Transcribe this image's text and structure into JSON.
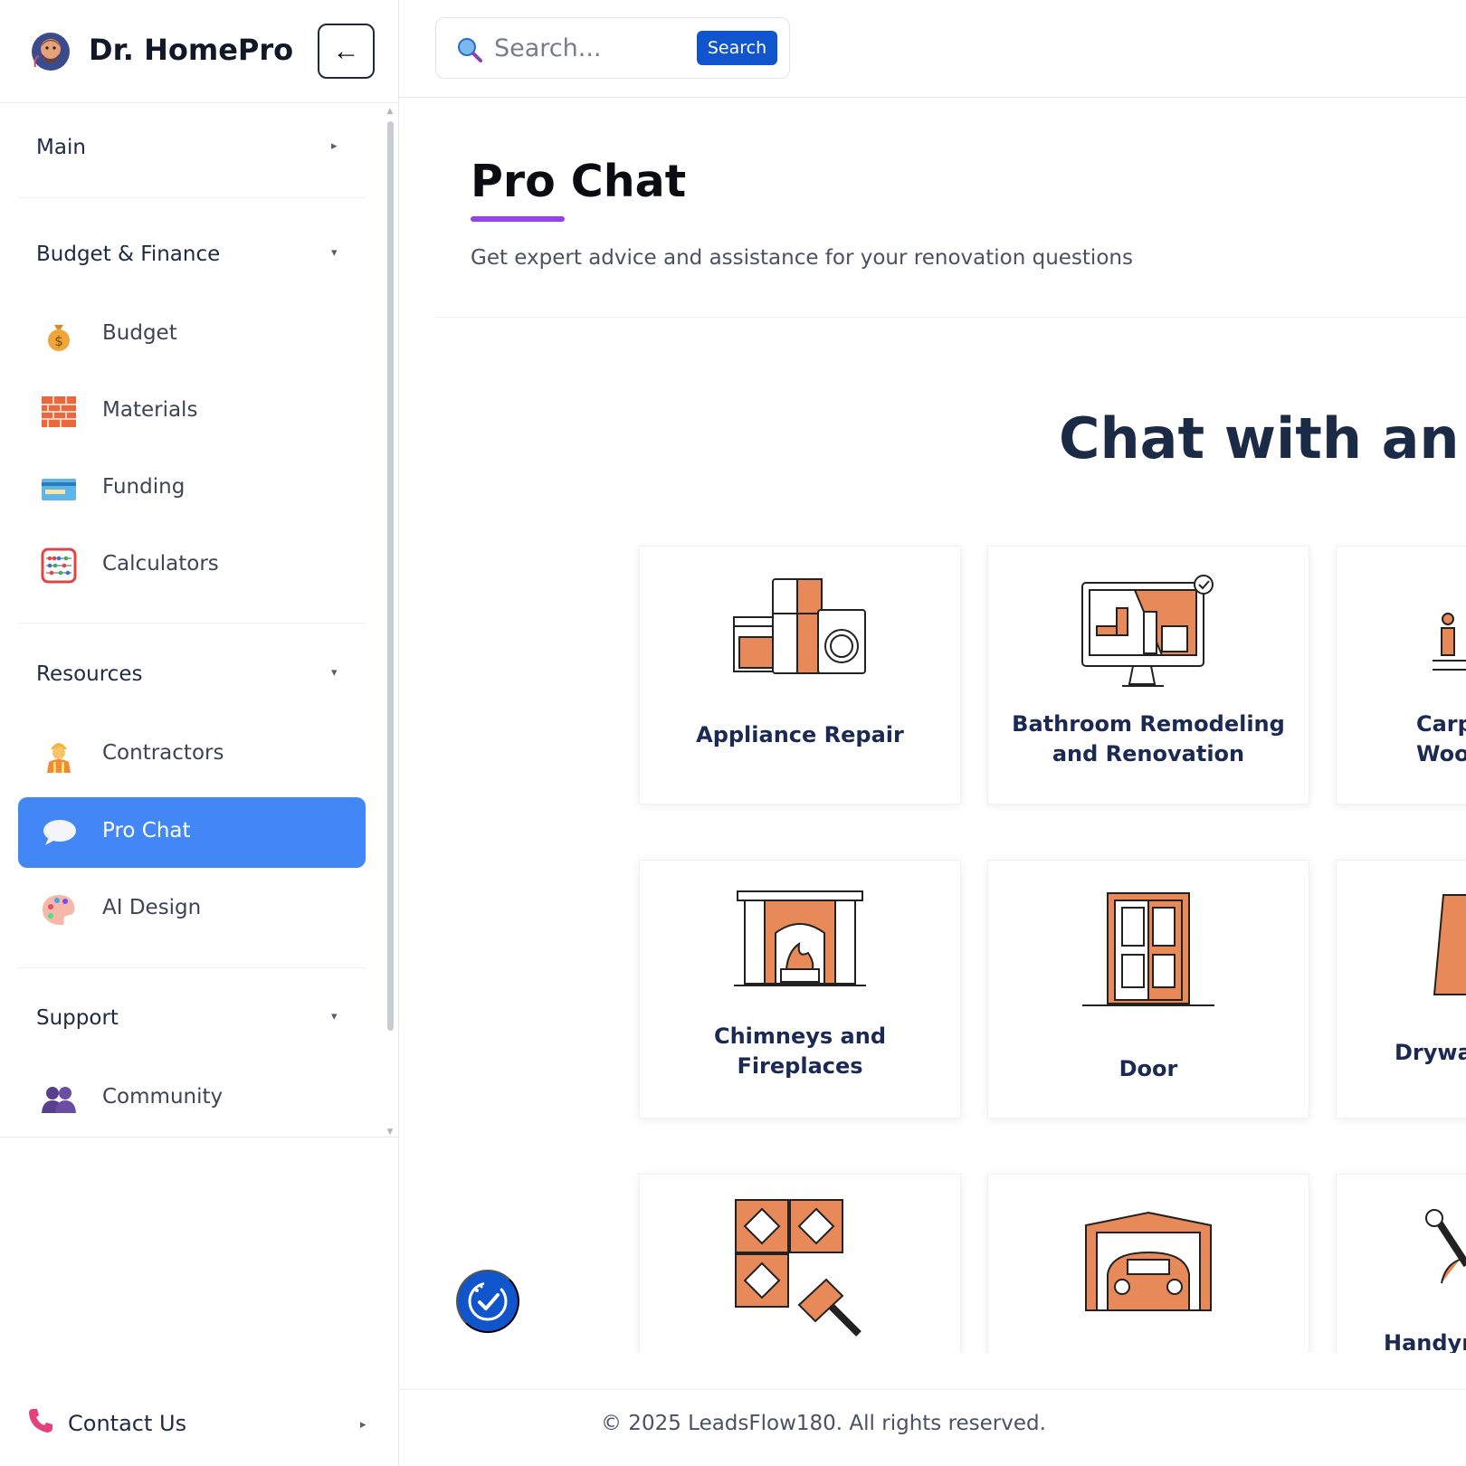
{
  "brand": {
    "name": "Dr. HomePro",
    "collapse_glyph": "←"
  },
  "nav": {
    "main": {
      "label": "Main",
      "caret": "▸"
    },
    "budget_finance": {
      "label": "Budget & Finance",
      "caret": "▾"
    },
    "budget_items": [
      {
        "label": "Budget",
        "icon": "money-bag-icon"
      },
      {
        "label": "Materials",
        "icon": "bricks-icon"
      },
      {
        "label": "Funding",
        "icon": "credit-card-icon"
      },
      {
        "label": "Calculators",
        "icon": "abacus-icon"
      }
    ],
    "resources": {
      "label": "Resources",
      "caret": "▾"
    },
    "resource_items": [
      {
        "label": "Contractors",
        "icon": "construction-worker-icon"
      },
      {
        "label": "Pro Chat",
        "icon": "speech-bubble-icon",
        "active": true
      },
      {
        "label": "AI Design",
        "icon": "palette-icon"
      }
    ],
    "support": {
      "label": "Support",
      "caret": "▾"
    },
    "support_items": [
      {
        "label": "Community",
        "icon": "people-icon"
      }
    ],
    "contact": {
      "label": "Contact Us",
      "caret": "▸",
      "icon": "phone-icon"
    },
    "accent": "#4287f5"
  },
  "search": {
    "placeholder": "Search...",
    "button_label": "Search"
  },
  "page": {
    "title": "Pro Chat",
    "subtitle": "Get expert advice and assistance for your renovation questions",
    "hero": "Chat with an Ex",
    "accent_underline": "#9b3df0"
  },
  "categories": [
    {
      "name_lines": [
        "Appliance Repair"
      ],
      "icon": "appliances-icon"
    },
    {
      "name_lines": [
        "Bathroom Remodeling",
        "and Renovation"
      ],
      "icon": "bathroom-monitor-icon"
    },
    {
      "name_lines": [
        "Carp",
        "Woo"
      ],
      "icon": "carpentry-icon"
    },
    {
      "name_lines": [
        "Chimneys and",
        "Fireplaces"
      ],
      "icon": "fireplace-icon"
    },
    {
      "name_lines": [
        "Door"
      ],
      "icon": "door-icon"
    },
    {
      "name_lines": [
        "Drywa"
      ],
      "icon": "drywall-icon"
    },
    {
      "name_lines": [
        ""
      ],
      "icon": "tiles-brush-icon"
    },
    {
      "name_lines": [
        ""
      ],
      "icon": "garage-car-icon"
    },
    {
      "name_lines": [
        "Handyr"
      ],
      "icon": "wrench-icon"
    }
  ],
  "footer": {
    "copyright": "© 2025 LeadsFlow180. All rights reserved."
  },
  "colors": {
    "orange": "#e8895a",
    "navy": "#1b2a55",
    "blue_button": "#1155cc"
  }
}
